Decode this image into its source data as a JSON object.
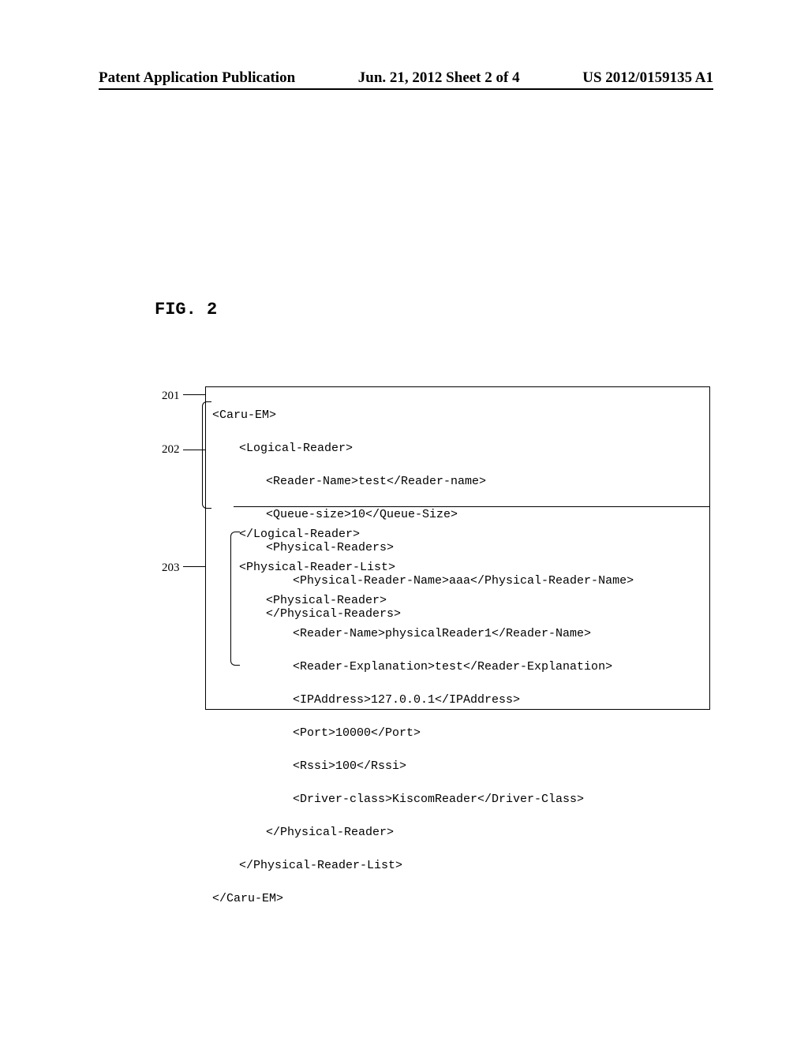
{
  "header": {
    "left": "Patent Application Publication",
    "center": "Jun. 21, 2012  Sheet 2 of 4",
    "right": "US 2012/0159135 A1"
  },
  "figure": {
    "label": "FIG. 2",
    "refs": {
      "r201": "201",
      "r202": "202",
      "r203": "203"
    },
    "code_top": {
      "l1": "<Caru-EM>",
      "l2": "<Logical-Reader>",
      "l3": "<Reader-Name>test</Reader-name>",
      "l4": "<Queue-size>10</Queue-Size>",
      "l5": "<Physical-Readers>",
      "l6": "<Physical-Reader-Name>aaa</Physical-Reader-Name>",
      "l7": "</Physical-Readers>"
    },
    "code_bottom": {
      "l1": "</Logical-Reader>",
      "l2": "<Physical-Reader-List>",
      "l3": "<Physical-Reader>",
      "l4": "<Reader-Name>physicalReader1</Reader-Name>",
      "l5": "<Reader-Explanation>test</Reader-Explanation>",
      "l6": "<IPAddress>127.0.0.1</IPAddress>",
      "l7": "<Port>10000</Port>",
      "l8": "<Rssi>100</Rssi>",
      "l9": "<Driver-class>KiscomReader</Driver-Class>",
      "l10": "</Physical-Reader>",
      "l11": "</Physical-Reader-List>",
      "l12": "</Caru-EM>"
    }
  }
}
